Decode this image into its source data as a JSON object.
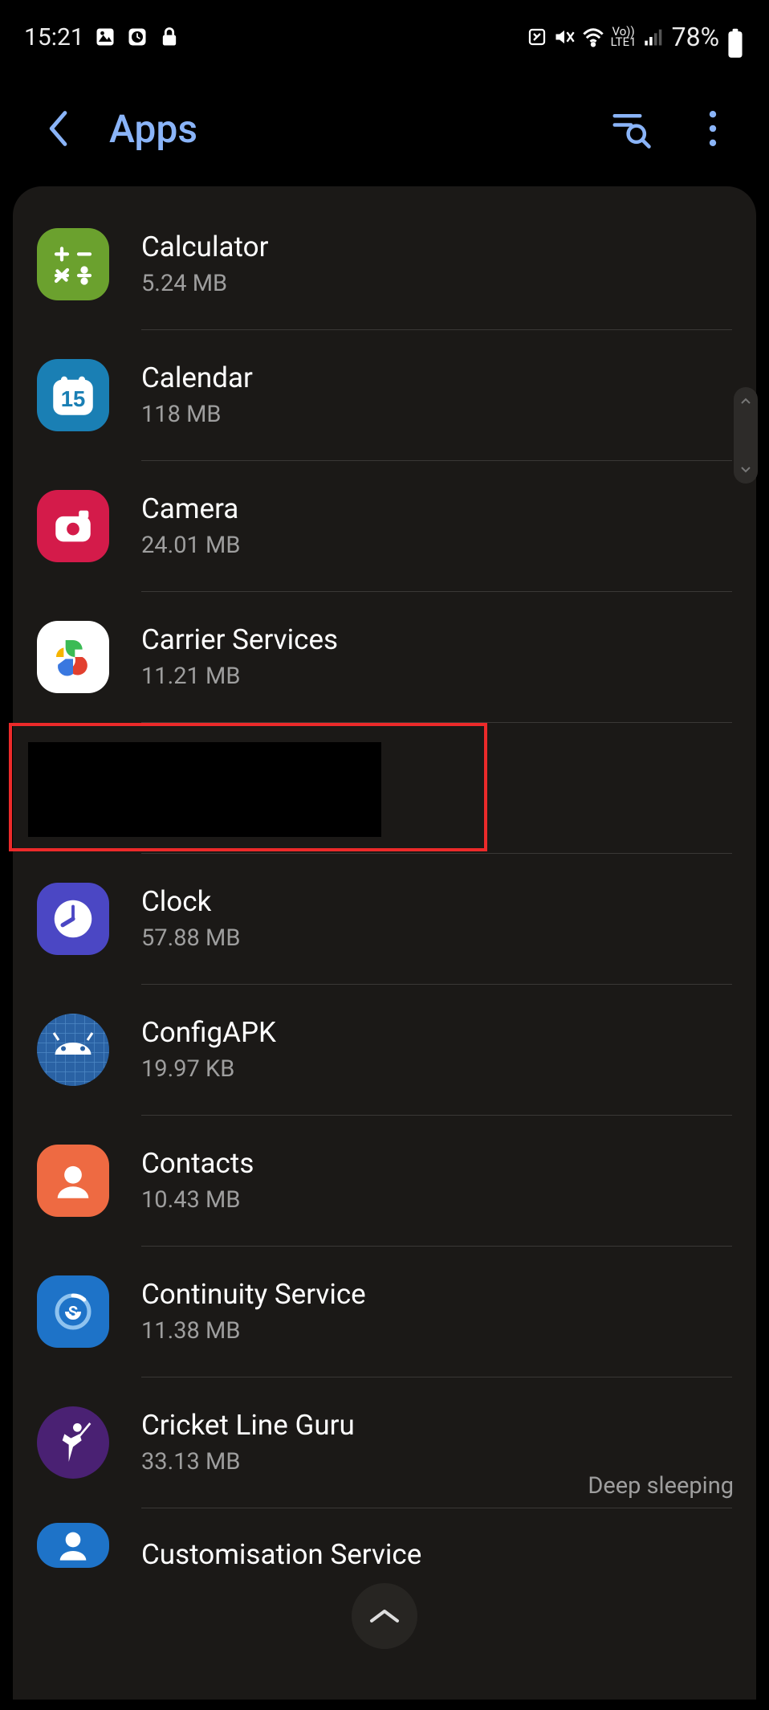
{
  "status": {
    "time": "15:21",
    "battery_pct": "78%",
    "network_label": "LTE1",
    "volte_label": "Vo))"
  },
  "header": {
    "title": "Apps"
  },
  "apps": [
    {
      "name": "Calculator",
      "size": "5.24 MB",
      "icon": "calculator",
      "bg": "#6ba12e"
    },
    {
      "name": "Calendar",
      "size": "118 MB",
      "icon": "calendar",
      "bg": "#1a7fb4",
      "day": "15"
    },
    {
      "name": "Camera",
      "size": "24.01 MB",
      "icon": "camera",
      "bg": "#d41b4a"
    },
    {
      "name": "Carrier Services",
      "size": "11.21 MB",
      "icon": "play-services",
      "bg": "#ffffff"
    },
    {
      "name": "",
      "size": "",
      "icon": "redacted"
    },
    {
      "name": "Clock",
      "size": "57.88 MB",
      "icon": "clock",
      "bg": "#4b47c4"
    },
    {
      "name": "ConfigAPK",
      "size": "19.97 KB",
      "icon": "android-grid",
      "bg": "#2a62a4"
    },
    {
      "name": "Contacts",
      "size": "10.43 MB",
      "icon": "contacts",
      "bg": "#ee6a42"
    },
    {
      "name": "Continuity Service",
      "size": "11.38 MB",
      "icon": "continuity",
      "bg": "#1e73c8"
    },
    {
      "name": "Cricket Line Guru",
      "size": "33.13 MB",
      "icon": "cricket",
      "bg": "#4a2173",
      "badge": "Deep sleeping"
    },
    {
      "name": "Customisation Service",
      "size": "",
      "icon": "customisation",
      "bg": "#1e73c8"
    }
  ]
}
